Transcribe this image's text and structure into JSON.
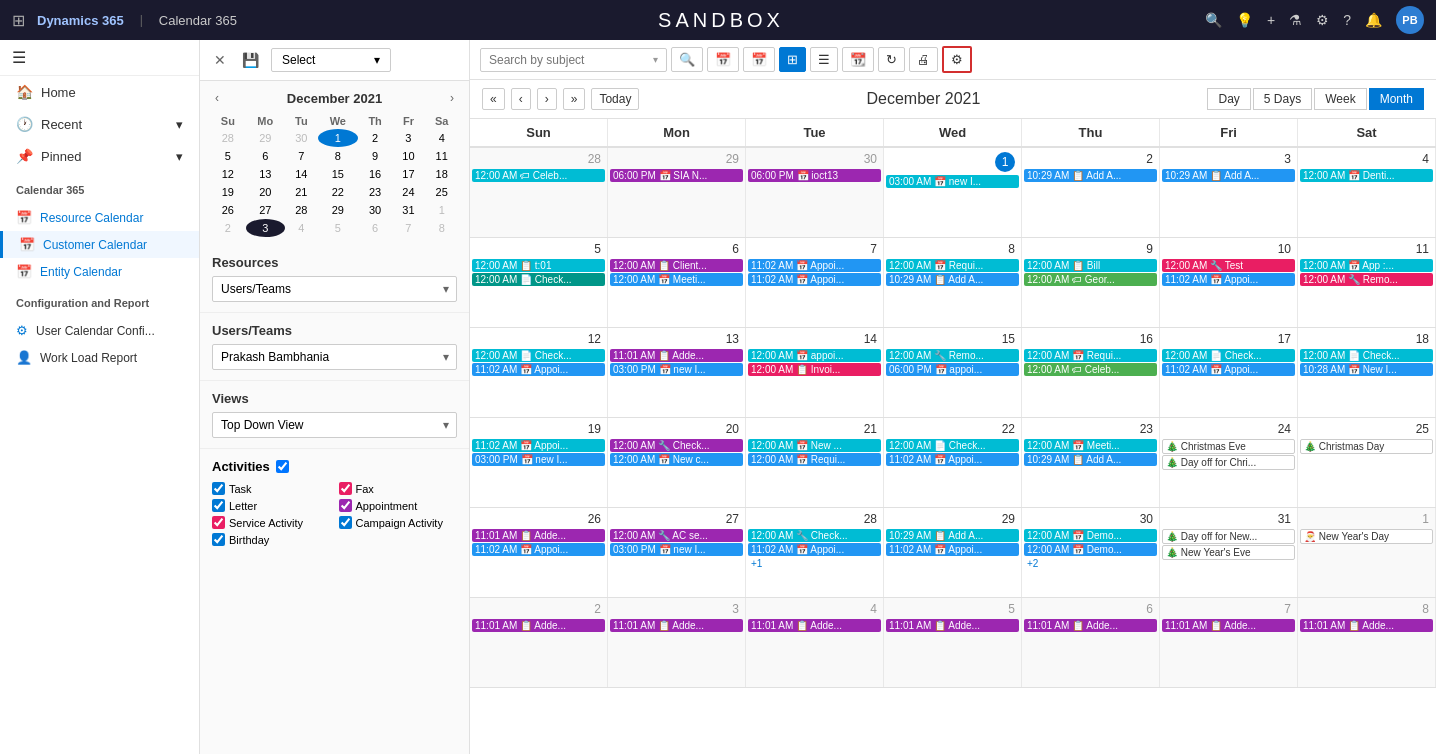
{
  "topNav": {
    "appTitle": "Dynamics 365",
    "separator": "|",
    "moduleTitle": "Calendar 365",
    "sandboxTitle": "SANDBOX",
    "avatarText": "PB"
  },
  "sidebar": {
    "navItems": [
      {
        "id": "home",
        "label": "Home",
        "icon": "🏠"
      },
      {
        "id": "recent",
        "label": "Recent",
        "icon": "🕐",
        "hasChevron": true
      },
      {
        "id": "pinned",
        "label": "Pinned",
        "icon": "📌",
        "hasChevron": true
      }
    ],
    "calendarSection": "Calendar 365",
    "calendarItems": [
      {
        "id": "resource",
        "label": "Resource Calendar",
        "icon": "📅",
        "active": false
      },
      {
        "id": "customer",
        "label": "Customer Calendar",
        "icon": "📅",
        "active": false
      },
      {
        "id": "entity",
        "label": "Entity Calendar",
        "icon": "📅",
        "active": false
      }
    ],
    "configSection": "Configuration and Report",
    "configItems": [
      {
        "id": "userconfig",
        "label": "User Calendar Confi...",
        "icon": "⚙"
      },
      {
        "id": "workload",
        "label": "Work Load Report",
        "icon": "👤"
      }
    ]
  },
  "middlePanel": {
    "toolbar": {
      "closeLabel": "✕",
      "saveLabel": "💾",
      "selectLabel": "Select",
      "selectChevron": "▾"
    },
    "miniCal": {
      "title": "December 2021",
      "prevLabel": "‹",
      "nextLabel": "›",
      "dayHeaders": [
        "Su",
        "Mo",
        "Tu",
        "We",
        "Th",
        "Fr",
        "Sa"
      ],
      "weeks": [
        [
          {
            "n": "28",
            "m": true
          },
          {
            "n": "29",
            "m": true
          },
          {
            "n": "30",
            "m": true
          },
          {
            "n": "1",
            "t": true
          },
          {
            "n": "2"
          },
          {
            "n": "3"
          },
          {
            "n": "4"
          }
        ],
        [
          {
            "n": "5"
          },
          {
            "n": "6"
          },
          {
            "n": "7"
          },
          {
            "n": "8"
          },
          {
            "n": "9"
          },
          {
            "n": "10"
          },
          {
            "n": "11"
          }
        ],
        [
          {
            "n": "12"
          },
          {
            "n": "13"
          },
          {
            "n": "14"
          },
          {
            "n": "15"
          },
          {
            "n": "16"
          },
          {
            "n": "17"
          },
          {
            "n": "18"
          }
        ],
        [
          {
            "n": "19"
          },
          {
            "n": "20"
          },
          {
            "n": "21"
          },
          {
            "n": "22"
          },
          {
            "n": "23"
          },
          {
            "n": "24"
          },
          {
            "n": "25"
          }
        ],
        [
          {
            "n": "26"
          },
          {
            "n": "27"
          },
          {
            "n": "28"
          },
          {
            "n": "29"
          },
          {
            "n": "30"
          },
          {
            "n": "31"
          },
          {
            "n": "1",
            "m": true
          }
        ],
        [
          {
            "n": "2",
            "m": true
          },
          {
            "n": "3",
            "sel": true
          },
          {
            "n": "4",
            "m": true
          },
          {
            "n": "5",
            "m": true
          },
          {
            "n": "6",
            "m": true
          },
          {
            "n": "7",
            "m": true
          },
          {
            "n": "8",
            "m": true
          }
        ]
      ]
    },
    "resources": {
      "label": "Resources",
      "value": "Users/Teams"
    },
    "usersTeams": {
      "label": "Users/Teams",
      "value": "Prakash Bambhania"
    },
    "views": {
      "label": "Views",
      "value": "Top Down View"
    },
    "activities": {
      "label": "Activities",
      "items": [
        {
          "id": "task",
          "label": "Task",
          "color": "#0078d4",
          "col": 1
        },
        {
          "id": "fax",
          "label": "Fax",
          "color": "#e91e63",
          "col": 2
        },
        {
          "id": "letter",
          "label": "Letter",
          "color": "#0078d4",
          "col": 1
        },
        {
          "id": "appointment",
          "label": "Appointment",
          "color": "#9c27b0",
          "col": 2
        },
        {
          "id": "serviceactivity",
          "label": "Service Activity",
          "color": "#e91e63",
          "col": 1
        },
        {
          "id": "campaignactivity",
          "label": "Campaign Activity",
          "color": "#0078d4",
          "col": 2
        },
        {
          "id": "birthday",
          "label": "Birthday",
          "color": "#0078d4",
          "col": 1
        }
      ]
    }
  },
  "mainPanel": {
    "searchPlaceholder": "Search by subject",
    "calTitle": "December 2021",
    "todayLabel": "Today",
    "viewBtns": [
      "Day",
      "5 Days",
      "Week",
      "Month"
    ],
    "activeView": "Month",
    "dayHeaders": [
      "Sun",
      "Mon",
      "Tue",
      "Wed",
      "Thu",
      "Fri",
      "Sat"
    ],
    "weeks": [
      {
        "cells": [
          {
            "date": "28",
            "other": true,
            "events": [
              {
                "label": "12:00 AM 🏷 Celeb...",
                "cls": "cyan"
              }
            ]
          },
          {
            "date": "29",
            "other": true,
            "events": [
              {
                "label": "06:00 PM 📅 SIA N...",
                "cls": "purple"
              }
            ]
          },
          {
            "date": "30",
            "other": true,
            "events": [
              {
                "label": "06:00 PM 📅 ioct13",
                "cls": "purple"
              }
            ]
          },
          {
            "date": "1",
            "today": true,
            "events": [
              {
                "label": "03:00 AM 📅 new I...",
                "cls": "cyan"
              }
            ]
          },
          {
            "date": "2",
            "events": [
              {
                "label": "10:29 AM 📋 Add A...",
                "cls": "blue"
              }
            ]
          },
          {
            "date": "3",
            "events": [
              {
                "label": "10:29 AM 📋 Add A...",
                "cls": "blue"
              }
            ]
          },
          {
            "date": "4",
            "weekend": true,
            "events": [
              {
                "label": "12:00 AM 📅 Denti...",
                "cls": "cyan"
              }
            ]
          }
        ]
      },
      {
        "cells": [
          {
            "date": "5",
            "events": [
              {
                "label": "12:00 AM 📋 t:01",
                "cls": "cyan"
              },
              {
                "label": "12:00 AM 📄 Check...",
                "cls": "teal"
              }
            ]
          },
          {
            "date": "6",
            "events": [
              {
                "label": "12:00 AM 📋 Client...",
                "cls": "purple"
              },
              {
                "label": "12:00 AM 📅 Meeti...",
                "cls": "blue"
              }
            ]
          },
          {
            "date": "7",
            "events": [
              {
                "label": "11:02 AM 📅 Appoi...",
                "cls": "blue"
              },
              {
                "label": "11:02 AM 📅 Appoi...",
                "cls": "blue"
              }
            ]
          },
          {
            "date": "8",
            "events": [
              {
                "label": "12:00 AM 📅 Requi...",
                "cls": "cyan"
              },
              {
                "label": "10:29 AM 📋 Add A...",
                "cls": "blue"
              }
            ]
          },
          {
            "date": "9",
            "events": [
              {
                "label": "12:00 AM 📋 Bill",
                "cls": "cyan"
              },
              {
                "label": "12:00 AM 🏷 Geor...",
                "cls": "green"
              }
            ]
          },
          {
            "date": "10",
            "events": [
              {
                "label": "12:00 AM 🔧 Test",
                "cls": "pink"
              },
              {
                "label": "11:02 AM 📅 Appoi...",
                "cls": "blue"
              }
            ]
          },
          {
            "date": "11",
            "weekend": true,
            "events": [
              {
                "label": "12:00 AM 📅 App :...",
                "cls": "cyan"
              },
              {
                "label": "12:00 AM 🔧 Remo...",
                "cls": "pink"
              }
            ]
          }
        ]
      },
      {
        "cells": [
          {
            "date": "12",
            "events": [
              {
                "label": "12:00 AM 📄 Check...",
                "cls": "cyan"
              },
              {
                "label": "11:02 AM 📅 Appoi...",
                "cls": "blue"
              }
            ]
          },
          {
            "date": "13",
            "events": [
              {
                "label": "11:01 AM 📋 Adde...",
                "cls": "purple"
              },
              {
                "label": "03:00 PM 📅 new I...",
                "cls": "blue"
              }
            ]
          },
          {
            "date": "14",
            "events": [
              {
                "label": "12:00 AM 📅 appoi...",
                "cls": "cyan"
              },
              {
                "label": "12:00 AM 📋 Invoi...",
                "cls": "pink"
              }
            ]
          },
          {
            "date": "15",
            "events": [
              {
                "label": "12:00 AM 🔧 Remo...",
                "cls": "cyan"
              },
              {
                "label": "06:00 PM 📅 appoi...",
                "cls": "blue"
              }
            ]
          },
          {
            "date": "16",
            "events": [
              {
                "label": "12:00 AM 📅 Requi...",
                "cls": "cyan"
              },
              {
                "label": "12:00 AM 🏷 Celeb...",
                "cls": "green"
              }
            ]
          },
          {
            "date": "17",
            "events": [
              {
                "label": "12:00 AM 📄 Check...",
                "cls": "cyan"
              },
              {
                "label": "11:02 AM 📅 Appoi...",
                "cls": "blue"
              }
            ]
          },
          {
            "date": "18",
            "weekend": true,
            "events": [
              {
                "label": "12:00 AM 📄 Check...",
                "cls": "cyan"
              },
              {
                "label": "10:28 AM 📅 New I...",
                "cls": "blue"
              }
            ]
          }
        ]
      },
      {
        "cells": [
          {
            "date": "19",
            "events": [
              {
                "label": "11:02 AM 📅 Appoi...",
                "cls": "cyan"
              },
              {
                "label": "03:00 PM 📅 new I...",
                "cls": "blue"
              }
            ]
          },
          {
            "date": "20",
            "events": [
              {
                "label": "12:00 AM 🔧 Check...",
                "cls": "purple"
              },
              {
                "label": "12:00 AM 📅 New c...",
                "cls": "blue"
              }
            ]
          },
          {
            "date": "21",
            "events": [
              {
                "label": "12:00 AM 📅 New ...",
                "cls": "cyan"
              },
              {
                "label": "12:00 AM 📅 Requi...",
                "cls": "blue"
              }
            ]
          },
          {
            "date": "22",
            "events": [
              {
                "label": "12:00 AM 📄 Check...",
                "cls": "cyan"
              },
              {
                "label": "11:02 AM 📅 Appoi...",
                "cls": "blue"
              }
            ]
          },
          {
            "date": "23",
            "events": [
              {
                "label": "12:00 AM 📅 Meeti...",
                "cls": "cyan"
              },
              {
                "label": "10:29 AM 📋 Add A...",
                "cls": "blue"
              }
            ]
          },
          {
            "date": "24",
            "events": [
              {
                "label": "🎄 Christmas Eve",
                "cls": "holiday"
              },
              {
                "label": "🎄 Day off for Chri...",
                "cls": "holiday"
              }
            ]
          },
          {
            "date": "25",
            "weekend": true,
            "events": [
              {
                "label": "🎄 Christmas Day",
                "cls": "holiday"
              }
            ]
          }
        ]
      },
      {
        "cells": [
          {
            "date": "26",
            "events": [
              {
                "label": "11:01 AM 📋 Adde...",
                "cls": "purple"
              },
              {
                "label": "11:02 AM 📅 Appoi...",
                "cls": "blue"
              }
            ]
          },
          {
            "date": "27",
            "events": [
              {
                "label": "12:00 AM 🔧 AC se...",
                "cls": "purple"
              },
              {
                "label": "03:00 PM 📅 new I...",
                "cls": "blue"
              }
            ]
          },
          {
            "date": "28",
            "events": [
              {
                "label": "12:00 AM 🔧 Check...",
                "cls": "cyan"
              },
              {
                "label": "11:02 AM 📅 Appoi...",
                "cls": "blue"
              },
              {
                "label": "+1",
                "cls": "more"
              }
            ]
          },
          {
            "date": "29",
            "events": [
              {
                "label": "10:29 AM 📋 Add A...",
                "cls": "cyan"
              },
              {
                "label": "11:02 AM 📅 Appoi...",
                "cls": "blue"
              }
            ]
          },
          {
            "date": "30",
            "events": [
              {
                "label": "12:00 AM 📅 Demo...",
                "cls": "cyan"
              },
              {
                "label": "12:00 AM 📅 Demo...",
                "cls": "blue"
              },
              {
                "label": "+2",
                "cls": "more"
              }
            ]
          },
          {
            "date": "31",
            "events": [
              {
                "label": "🎄 Day off for New...",
                "cls": "holiday"
              },
              {
                "label": "🎄 New Year's Eve",
                "cls": "holiday"
              }
            ]
          },
          {
            "date": "1",
            "other": true,
            "weekend": true,
            "events": [
              {
                "label": "🎅 New Year's Day",
                "cls": "holiday"
              }
            ]
          }
        ]
      },
      {
        "cells": [
          {
            "date": "2",
            "other": true,
            "events": [
              {
                "label": "11:01 AM 📋 Adde...",
                "cls": "purple"
              }
            ]
          },
          {
            "date": "3",
            "other": true,
            "events": [
              {
                "label": "11:01 AM 📋 Adde...",
                "cls": "purple"
              }
            ]
          },
          {
            "date": "4",
            "other": true,
            "events": [
              {
                "label": "11:01 AM 📋 Adde...",
                "cls": "purple"
              }
            ]
          },
          {
            "date": "5",
            "other": true,
            "events": [
              {
                "label": "11:01 AM 📋 Adde...",
                "cls": "purple"
              }
            ]
          },
          {
            "date": "6",
            "other": true,
            "events": [
              {
                "label": "11:01 AM 📋 Adde...",
                "cls": "purple"
              }
            ]
          },
          {
            "date": "7",
            "other": true,
            "events": [
              {
                "label": "11:01 AM 📋 Adde...",
                "cls": "purple"
              }
            ]
          },
          {
            "date": "8",
            "other": true,
            "weekend": true,
            "events": [
              {
                "label": "11:01 AM 📋 Adde...",
                "cls": "purple"
              }
            ]
          }
        ]
      }
    ]
  }
}
